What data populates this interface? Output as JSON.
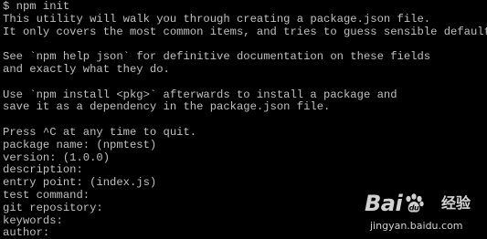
{
  "terminal": {
    "lines": [
      "$ npm init",
      "This utility will walk you through creating a package.json file.",
      "It only covers the most common items, and tries to guess sensible defaults.",
      "",
      "See `npm help json` for definitive documentation on these fields",
      "and exactly what they do.",
      "",
      "Use `npm install <pkg>` afterwards to install a package and",
      "save it as a dependency in the package.json file.",
      "",
      "Press ^C at any time to quit.",
      "package name: (npmtest)",
      "version: (1.0.0)",
      "description:",
      "entry point: (index.js)",
      "test command:",
      "git repository:",
      "keywords:",
      "author:"
    ],
    "text_color": "#c0c0c0",
    "background_color": "#000000"
  },
  "watermark": {
    "logo_text_left": "Bai",
    "logo_text_right": "经验",
    "url": "jingyan.baidu.com",
    "paw_icon": "baidu-paw-icon"
  }
}
